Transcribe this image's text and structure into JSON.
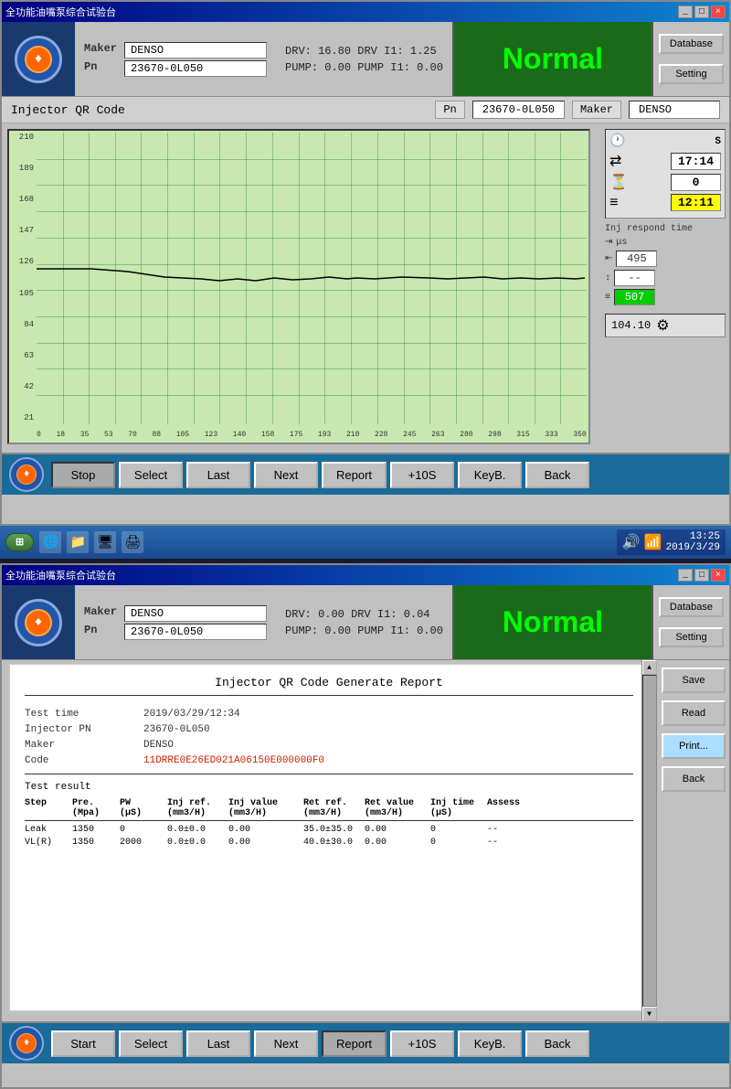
{
  "panel1": {
    "title": "全功能油嘴泵综合试验台",
    "header": {
      "maker_label": "Maker",
      "maker_value": "DENSO",
      "pn_label": "Pn",
      "pn_value": "23670-0L050",
      "drv_label": "DRV:",
      "drv_value": "16.80",
      "drv_i1_label": "DRV I1:",
      "drv_i1_value": "1.25",
      "pump_label": "PUMP:",
      "pump_value": "0.00",
      "pump_i1_label": "PUMP I1:",
      "pump_i1_value": "0.00",
      "status": "Normal"
    },
    "qr": {
      "title": "Injector QR Code",
      "pn_label": "Pn",
      "pn_value": "23670-0L050",
      "maker_label": "Maker",
      "maker_value": "DENSO"
    },
    "chart": {
      "y_labels": [
        "210",
        "189",
        "168",
        "147",
        "126",
        "105",
        "84",
        "63",
        "42",
        "21"
      ],
      "x_labels": [
        "0",
        "18",
        "35",
        "53",
        "70",
        "88",
        "105",
        "123",
        "140",
        "158",
        "175",
        "193",
        "210",
        "228",
        "245",
        "263",
        "280",
        "298",
        "315",
        "333",
        "350"
      ]
    },
    "side": {
      "s_label": "S",
      "time1": "17:14",
      "val2": "0",
      "time2": "12:11",
      "inj_title": "Inj respond time",
      "us_label": "μs",
      "val_495": "495",
      "val_dash": "--",
      "val_507": "507",
      "reading": "104.10"
    },
    "toolbar": {
      "stop": "Stop",
      "select": "Select",
      "last": "Last",
      "next": "Next",
      "report": "Report",
      "plus10s": "+10S",
      "keyb": "KeyB.",
      "back": "Back"
    }
  },
  "taskbar": {
    "time": "13:25",
    "date": "2019/3/29",
    "icons": [
      "🌐",
      "📁",
      "🖥",
      "🖨"
    ]
  },
  "panel2": {
    "title": "全功能油嘴泵综合试验台",
    "header": {
      "maker_label": "Maker",
      "maker_value": "DENSO",
      "pn_label": "Pn",
      "pn_value": "23670-0L050",
      "drv_label": "DRV:",
      "drv_value": "0.00",
      "drv_i1_label": "DRV I1:",
      "drv_i1_value": "0.04",
      "pump_label": "PUMP:",
      "pump_value": "0.00",
      "pump_i1_label": "PUMP I1:",
      "pump_i1_value": "0.00",
      "status": "Normal"
    },
    "report": {
      "title": "Injector QR Code Generate Report",
      "test_time_label": "Test time",
      "test_time_value": "2019/03/29/12:34",
      "injector_pn_label": "Injector PN",
      "injector_pn_value": "23670-0L050",
      "maker_label": "Maker",
      "maker_value": "DENSO",
      "code_label": "Code",
      "code_value": "11DRRE0E26ED021A06150E000000F0",
      "test_result_label": "Test result",
      "table_headers": [
        "Step",
        "Pre.\n(Mpa)",
        "PW\n(μS)",
        "Inj ref.\n(mm3/H)",
        "Inj value\n(mm3/H)",
        "Ret ref.\n(mm3/H)",
        "Ret value\n(mm3/H)",
        "Inj time\n(μS)",
        "Assess"
      ],
      "table_col1": [
        "Step",
        "Leak",
        "VL(R)"
      ],
      "table_col2": [
        "Pre.\n(Mpa)",
        "1350",
        "1350"
      ],
      "table_col3": [
        "PW\n(μS)",
        "0",
        "2000"
      ],
      "table_col4": [
        "Inj ref.\n(mm3/H)",
        "0.0±0.0",
        "0.0±0.0"
      ],
      "table_col5": [
        "Inj value\n(mm3/H)",
        "0.00",
        "0.00"
      ],
      "table_col6": [
        "Ret ref.\n(mm3/H)",
        "35.0±35.0",
        "40.0±30.0"
      ],
      "table_col7": [
        "Ret value\n(mm3/H)",
        "0.00",
        "0.00"
      ],
      "table_col8": [
        "Inj time\n(μS)",
        "0",
        "0"
      ],
      "table_col9": [
        "Assess",
        "--",
        "--"
      ]
    },
    "side_buttons": {
      "save": "Save",
      "read": "Read",
      "print": "Print...",
      "back": "Back"
    },
    "toolbar": {
      "start": "Start",
      "select": "Select",
      "last": "Last",
      "next": "Next",
      "report": "Report",
      "plus10s": "+10S",
      "keyb": "KeyB.",
      "back": "Back"
    }
  }
}
